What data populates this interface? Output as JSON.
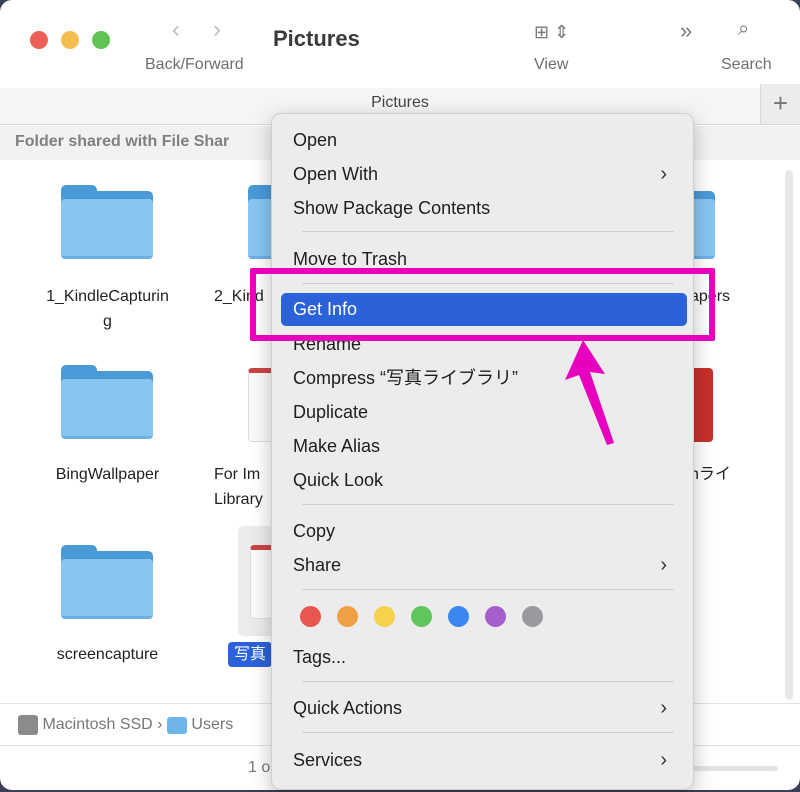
{
  "window": {
    "title": "Pictures",
    "tab": "Pictures",
    "new_tab": "+"
  },
  "toolbar": {
    "back_forward_label": "Back/Forward",
    "view_label": "View",
    "search_label": "Search",
    "more_icon": "chevron-double-right"
  },
  "info_bar": "Folder shared with File Shar",
  "files": [
    {
      "name": "1_KindleCapturin\ng",
      "kind": "folder"
    },
    {
      "name": "2_Kind",
      "kind": "folder"
    },
    {
      "name": "apers",
      "kind": "folder"
    },
    {
      "name": "BingWallpaper",
      "kind": "folder"
    },
    {
      "name": "For Im\nLibrary",
      "kind": "photos-library"
    },
    {
      "name": "hライ",
      "kind": "photos-library"
    },
    {
      "name": "screencapture",
      "kind": "folder"
    },
    {
      "name": "写真",
      "kind": "photos-library",
      "selected": true
    }
  ],
  "path_bar": {
    "items": [
      "Macintosh SSD",
      "Users"
    ]
  },
  "status_bar": {
    "text": "1 o"
  },
  "context_menu": {
    "items": [
      "Open",
      "Open With",
      "Show Package Contents",
      "Move to Trash",
      "Get Info",
      "Rename",
      "Compress “写真ライブラリ”",
      "Duplicate",
      "Make Alias",
      "Quick Look",
      "Copy",
      "Share",
      "Tags...",
      "Quick Actions",
      "Services"
    ],
    "highlighted": "Get Info",
    "tag_colors": [
      "#e9564f",
      "#f0a044",
      "#f5d14c",
      "#5fc659",
      "#3b86f0",
      "#a55fcc",
      "#9a9a9e"
    ]
  },
  "annotation": {
    "color": "#e800bf"
  },
  "colors": {
    "close": "#ee5f57",
    "minimize": "#f4bd4f",
    "zoom": "#5fc454",
    "accent": "#2b62d9"
  }
}
